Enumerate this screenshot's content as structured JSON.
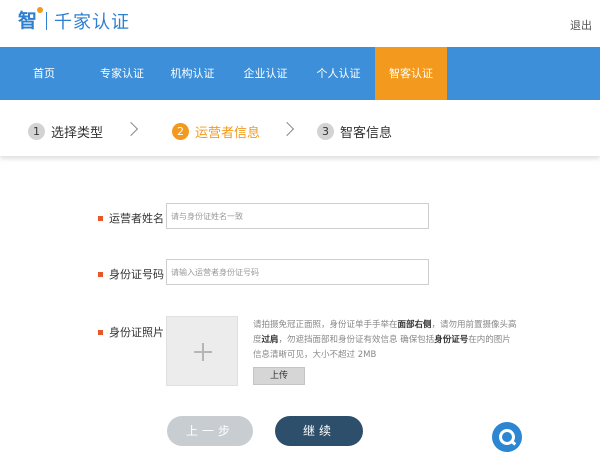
{
  "header": {
    "logo_mark": "智",
    "logo_text": "千家认证",
    "logout_label": "退出"
  },
  "nav": {
    "items": [
      {
        "label": "首页"
      },
      {
        "label": "专家认证"
      },
      {
        "label": "机构认证"
      },
      {
        "label": "企业认证"
      },
      {
        "label": "个人认证"
      },
      {
        "label": "智客认证",
        "active": true
      }
    ]
  },
  "steps": [
    {
      "num": "1",
      "label": "选择类型"
    },
    {
      "num": "2",
      "label": "运营者信息",
      "active": true
    },
    {
      "num": "3",
      "label": "智客信息"
    }
  ],
  "form": {
    "name": {
      "label": "运营者姓名",
      "placeholder": "请与身份证姓名一致",
      "value": ""
    },
    "id_number": {
      "label": "身份证号码",
      "placeholder": "请输入运营者身份证号码",
      "value": ""
    },
    "id_photo": {
      "label": "身份证照片",
      "hint_1": "请拍摄免冠正面照，身份证单手手举在",
      "hint_2": "面部右侧",
      "hint_3": "，请勿用前置摄像头高度",
      "hint_4": "过肩",
      "hint_5": "，勿遮挡面部和身份证有效信息 确保包括",
      "hint_6": "身份证号",
      "hint_7": "在内的图片信息清晰可见，大小不超过 2MB",
      "upload_label": "上传"
    }
  },
  "actions": {
    "prev_label": "上一步",
    "next_label": "继续"
  },
  "colors": {
    "primary": "#3c8fd8",
    "accent": "#f39a1e",
    "button_dark": "#2d4f6b",
    "bullet": "#e8572a"
  },
  "icons": {
    "chat": "chat-bubble-icon",
    "plus": "plus-icon",
    "chevron": "chevron-right-icon"
  }
}
